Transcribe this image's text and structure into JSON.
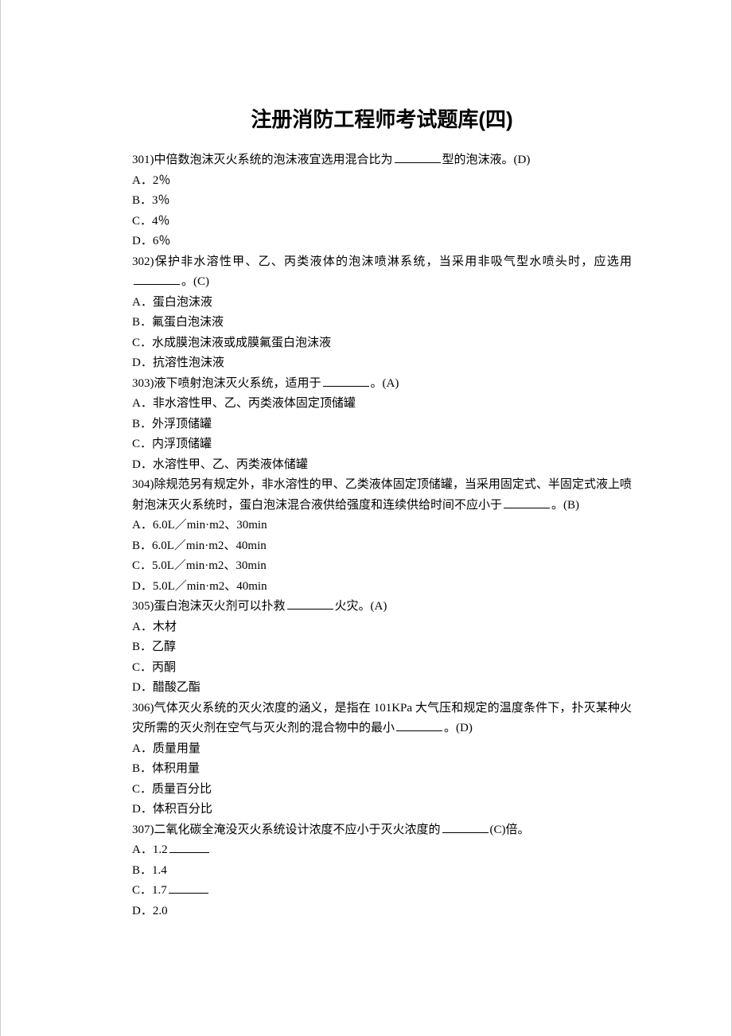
{
  "title": "注册消防工程师考试题库(四)",
  "questions": [
    {
      "num": "301)",
      "stem_pre": "中倍数泡沫灭火系统的泡沫液宜选用混合比为",
      "stem_post": "型的泡沫液。(D)",
      "options": [
        "A．2％",
        "B．3％",
        "C．4％",
        "D．6％"
      ]
    },
    {
      "num": "302)",
      "stem_pre": "保护非水溶性甲、乙、丙类液体的泡沫喷淋系统，当采用非吸气型水喷头时，应选用",
      "stem_post": "。(C)",
      "options": [
        "A．蛋白泡沫液",
        "B．氟蛋白泡沫液",
        "C．水成膜泡沫液或成膜氟蛋白泡沫液",
        "D．抗溶性泡沫液"
      ]
    },
    {
      "num": "303)",
      "stem_pre": "液下喷射泡沫灭火系统，适用于",
      "stem_post": "。(A)",
      "options": [
        "A．非水溶性甲、乙、丙类液体固定顶储罐",
        "B．外浮顶储罐",
        "C．内浮顶储罐",
        "D．水溶性甲、乙、丙类液体储罐"
      ]
    },
    {
      "num": "304)",
      "stem_pre": "除规范另有规定外，非水溶性的甲、乙类液体固定顶储罐，当采用固定式、半固定式液上喷射泡沫灭火系统时，蛋白泡沫混合液供给强度和连续供给时间不应小于",
      "stem_post": "。(B)",
      "options": [
        "A．6.0L／min·m2、30min",
        "B．6.0L／min·m2、40min",
        "C．5.0L／min·m2、30min",
        "D．5.0L／min·m2、40min"
      ]
    },
    {
      "num": "305)",
      "stem_pre": "蛋白泡沫灭火剂可以扑救",
      "stem_post": "火灾。(A)",
      "options": [
        "A．木材",
        "B．乙醇",
        "C．丙酮",
        "D．醋酸乙酯"
      ]
    },
    {
      "num": "306)",
      "stem_pre": "气体灭火系统的灭火浓度的涵义，是指在 101KPa 大气压和规定的温度条件下，扑灭某种火灾所需的灭火剂在空气与灭火剂的混合物中的最小",
      "stem_post": "。(D)",
      "options": [
        "A．质量用量",
        "B．体积用量",
        "C．质量百分比",
        "D．体积百分比"
      ]
    },
    {
      "num": "307)",
      "stem_pre": "二氧化碳全淹没灭火系统设计浓度不应小于灭火浓度的",
      "stem_post": "(C)倍。",
      "options": [
        "A．1.2",
        "B．1.4",
        "C．1.7",
        "D．2.0"
      ],
      "option_blank": [
        true,
        false,
        true,
        false
      ]
    }
  ]
}
